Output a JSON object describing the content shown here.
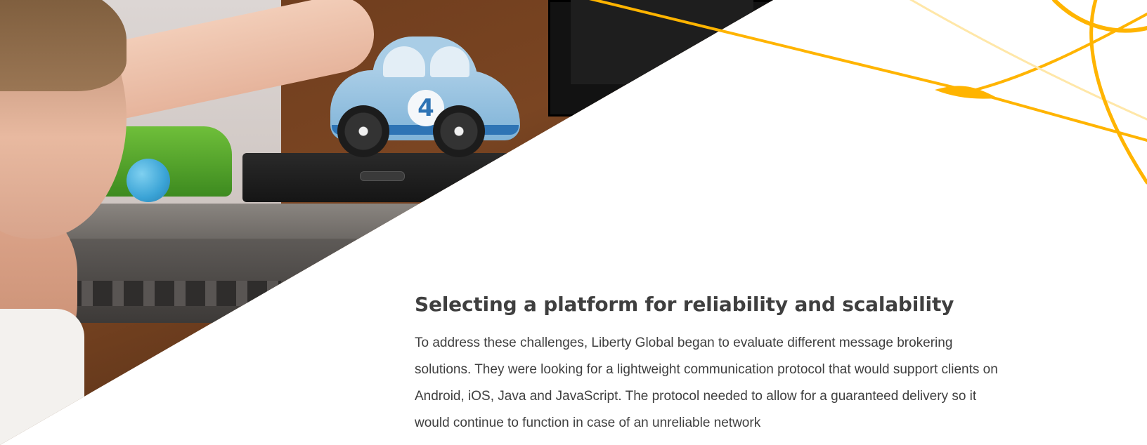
{
  "theme": {
    "accent": "#FFB400",
    "text": "#3F3F3F",
    "background": "#FFFFFF"
  },
  "hero": {
    "car_number": "4"
  },
  "section": {
    "heading": "Selecting a platform for reliability and scalability",
    "paragraph": "To address these challenges, Liberty Global began to evaluate different message brokering solutions. They were looking for a lightweight communication protocol that would support clients on Android, iOS, Java and JavaScript. The protocol needed to allow for a guaranteed delivery so it would continue to function in case of an unreliable network"
  }
}
